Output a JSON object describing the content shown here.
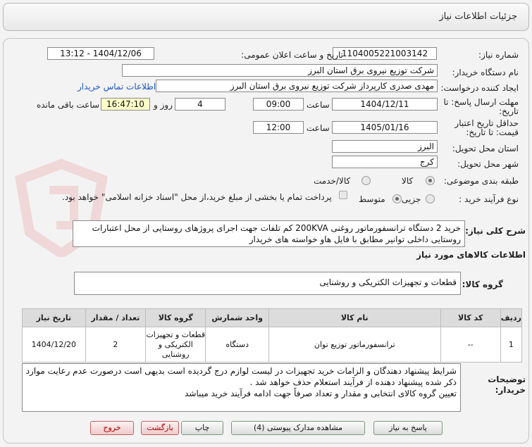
{
  "header": {
    "title": "جزئیات اطلاعات نیاز"
  },
  "fields": {
    "need_number_label": "شماره نیاز:",
    "need_number": "1104005221003142",
    "announce_label": "تاریخ و ساعت اعلان عمومی:",
    "announce_value": "1404/12/06 - 13:12",
    "buyer_label": "نام دستگاه خریدار:",
    "buyer_value": "شرکت توزیع نیروی برق استان البرز",
    "creator_label": "ایجاد کننده درخواست:",
    "creator_value": "مهدی صدری کارپرداز شرکت توزیع نیروی برق استان البرز",
    "contact_link": "اطلاعات تماس خریدار",
    "deadline_label_1": "مهلت ارسال پاسخ: تا",
    "deadline_label_2": "تاریخ:",
    "deadline_date": "1404/12/11",
    "time_label": "ساعت",
    "deadline_time": "09:00",
    "days_value": "4",
    "days_label": "روز و",
    "remaining_value": "16:47:10",
    "remaining_label": "ساعت باقی مانده",
    "validity_label_1": "حداقل تاریخ اعتبار",
    "validity_label_2": "قیمت: تا تاریخ:",
    "validity_date": "1405/01/16",
    "validity_time_label": "ساعت",
    "validity_time": "12:00",
    "province_label": "استان محل تحویل:",
    "province_value": "البرز",
    "city_label": "شهر محل تحویل:",
    "city_value": "کرج",
    "category_label": "طبقه بندی موضوعی:",
    "category_options": [
      "کالا",
      "کالا/خدمت"
    ],
    "process_label": "نوع فرآیند خرید :",
    "process_options": [
      "جزیی",
      "متوسط"
    ],
    "payment_note": "پرداخت تمام یا بخشی از مبلغ خرید،از محل \"اسناد خزانه اسلامی\" خواهد بود."
  },
  "description": {
    "label": "شرح کلی نیاز:",
    "line1": "خرید 2 دستگاه ترانسفورماتور روغنی 200KVA کم تلفات جهت اجرای پروژهای روستایی از محل اعتبارات",
    "line2": "روستایی داخلی توانیر مطابق با فایل هاو خواسته های خریدار"
  },
  "goods": {
    "section_title": "اطلاعات کالاهای مورد نیاز",
    "group_label": "گروه کالا:",
    "group_value": "قطعات و تجهیزات الکتریکی و روشنایی"
  },
  "table": {
    "headers": [
      "ردیف",
      "کد کالا",
      "نام کالا",
      "واحد شمارش",
      "گروه کالا",
      "تعداد / مقدار",
      "تاریخ نیاز"
    ],
    "rows": [
      {
        "row": "1",
        "code": "--",
        "name": "ترانسفورماتور توزیع توان",
        "unit": "دستگاه",
        "group_l1": "قطعات و تجهیزات",
        "group_l2": "الکتریکی و",
        "group_l3": "روشنایی",
        "qty": "2",
        "date": "1404/12/20"
      }
    ]
  },
  "notes": {
    "label_1": "توضیحات",
    "label_2": "خریدار:",
    "line1": "شرایط پیشنهاد دهندگان و الزامات خرید تجهیزات در لیست لوازم درج گردیده است بدیهی است درصورت عدم رعایت موارد",
    "line2": "ذکر شده پیشنهاد دهنده از فرآیند استعلام حذف خواهد شد .",
    "line3": "تعیین گروه کالای انتخابی و مقدار و تعداد صرفاً جهت ادامه فرآیند خرید میباشد"
  },
  "buttons": {
    "reply": "پاسخ به نیاز",
    "docs": "مشاهده مدارک پیوستی (4)",
    "print": "چاپ",
    "back": "بازگشت",
    "exit": "خروج"
  }
}
